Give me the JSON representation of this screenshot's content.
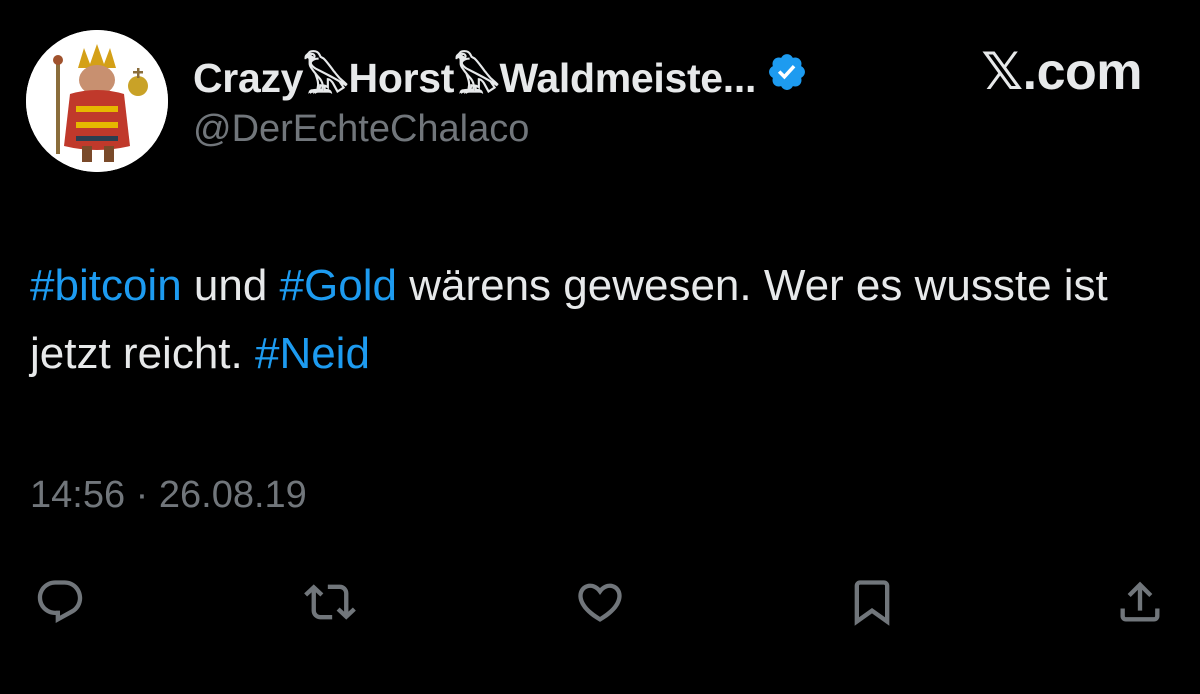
{
  "brand": "𝕏.com",
  "author": {
    "display_name": "Crazy𓅃Horst𓅃Waldmeiste...",
    "handle": "@DerEchteChalaco",
    "verified": true,
    "avatar_icon": "avatar-image"
  },
  "tweet": {
    "segments": [
      {
        "text": "#bitcoin",
        "hashtag": true
      },
      {
        "text": " und ",
        "hashtag": false
      },
      {
        "text": "#Gold",
        "hashtag": true
      },
      {
        "text": " wärens gewesen. Wer es wusste ist jetzt reicht. ",
        "hashtag": false
      },
      {
        "text": "#Neid",
        "hashtag": true
      }
    ]
  },
  "timestamp": "14:56 · 26.08.19",
  "actions": [
    {
      "name": "reply",
      "icon": "reply-icon"
    },
    {
      "name": "retweet",
      "icon": "retweet-icon"
    },
    {
      "name": "like",
      "icon": "like-icon"
    },
    {
      "name": "bookmark",
      "icon": "bookmark-icon"
    },
    {
      "name": "share",
      "icon": "share-icon"
    }
  ],
  "colors": {
    "background": "#000000",
    "text": "#e7e9ea",
    "muted": "#71767b",
    "accent": "#1d9bf0"
  }
}
